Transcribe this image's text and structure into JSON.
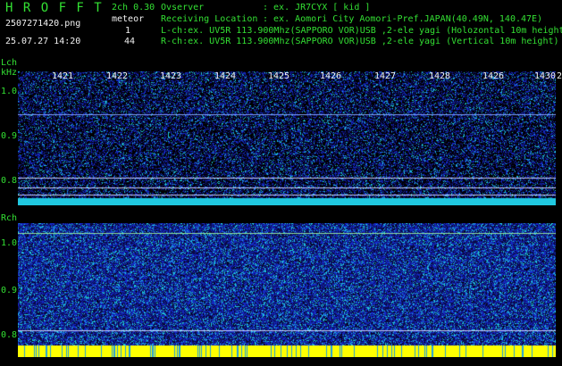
{
  "header": {
    "app_title": "H R O F F T",
    "mode": "2ch 0.30",
    "filename": "2507271420.png",
    "datetime": "25.07.27 14:20",
    "meteor_label": "meteor",
    "meteor_lch": "1",
    "meteor_rch": "44",
    "observer_label": "Ovserver",
    "observer_value": ": ex. JR7CYX [ kid ]",
    "location_label": "Receiving Location",
    "location_value": ": ex. Aomori City Aomori-Pref.JAPAN(40.49N, 140.47E)",
    "lch_info": "L-ch:ex. UV5R 113.900Mhz(SAPPORO VOR)USB ,2-ele yagi (Holozontal 10m height",
    "rch_info": "R-ch:ex. UV5R 113.900Mhz(SAPPORO VOR)USB ,2-ele yagi (Vertical 10m height)"
  },
  "lch_panel": {
    "label": "Lch",
    "unit": "kHz",
    "y_ticks": [
      "1.0",
      "0.9",
      "0.8"
    ],
    "time_ticks": [
      "1421",
      "1422",
      "1423",
      "1424",
      "1425",
      "1426",
      "1427",
      "1428",
      "1426",
      "1430",
      "2"
    ]
  },
  "rch_panel": {
    "label": "Rch",
    "y_ticks": [
      "1.0",
      "0.9",
      "0.8"
    ]
  },
  "colors": {
    "text_green": "#33e033",
    "text_white": "#f2f2f2",
    "background": "#000000",
    "noise_blue": "#1a2a9c",
    "noise_cyan": "#20d0e0",
    "signal_yellow": "#ffff00"
  }
}
